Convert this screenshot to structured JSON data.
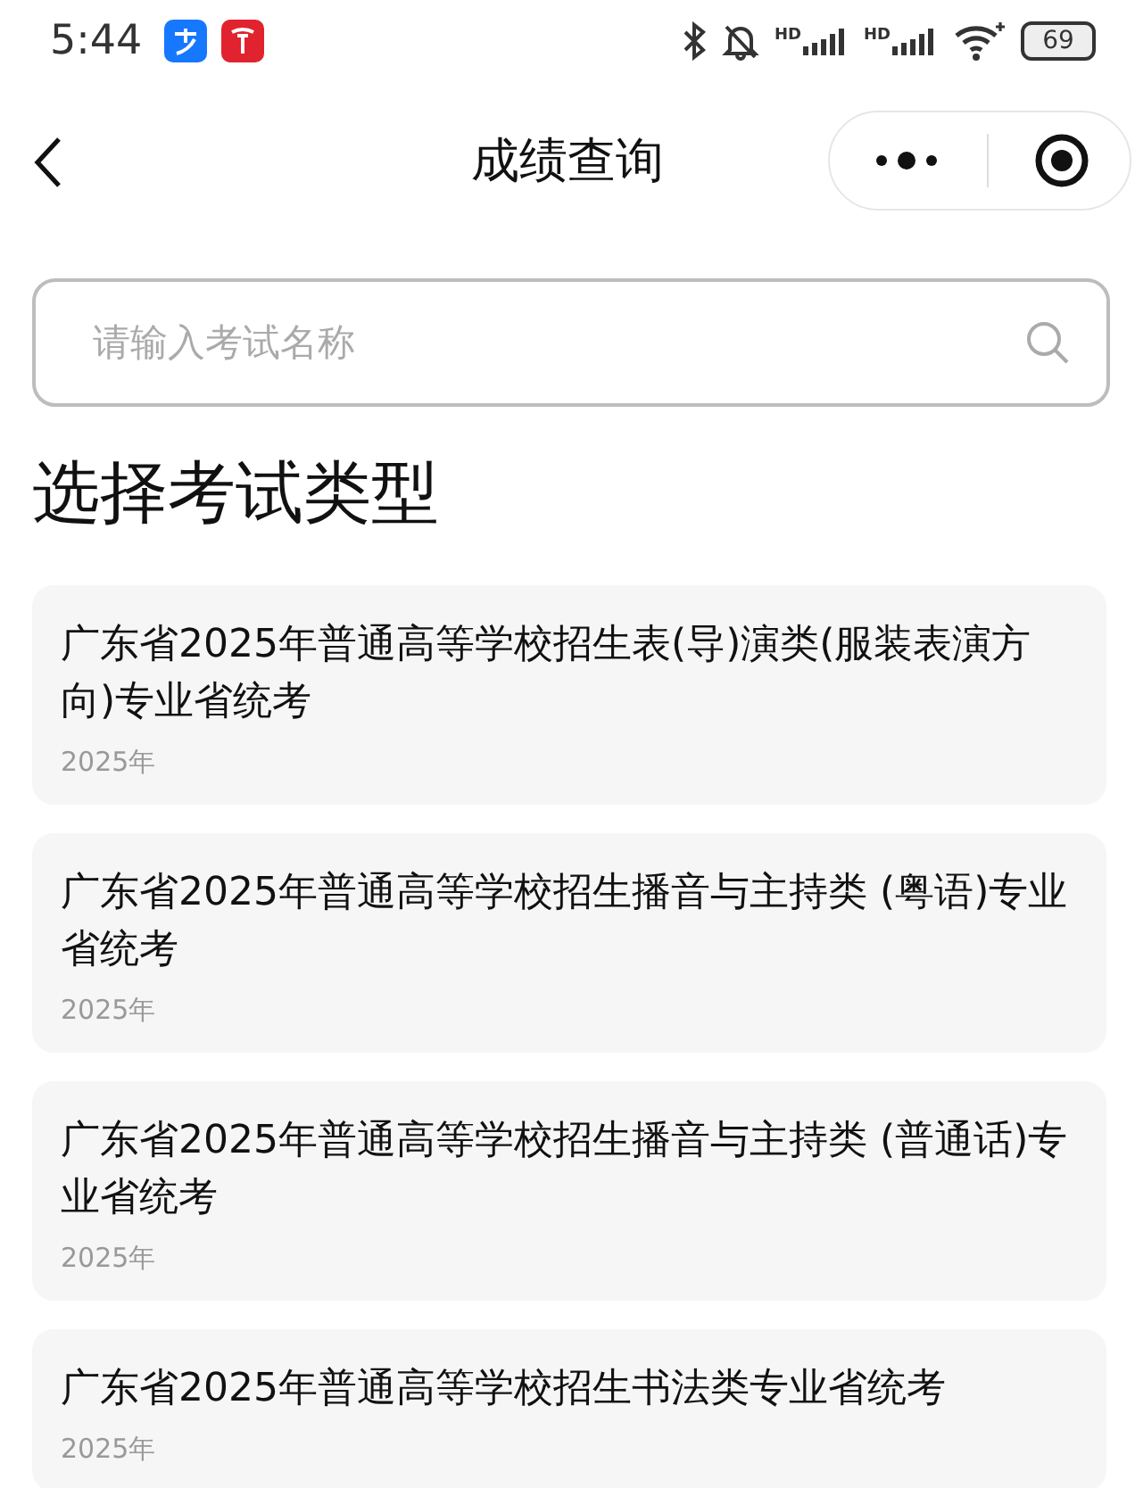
{
  "status_bar": {
    "time": "5:44",
    "signal_labels": [
      "HD",
      "HD"
    ],
    "battery": "69"
  },
  "header": {
    "title": "成绩查询"
  },
  "search": {
    "placeholder": "请输入考试名称"
  },
  "section_title": "选择考试类型",
  "exams": [
    {
      "title": "广东省2025年普通高等学校招生表(导)演类(服装表演方向)专业省统考",
      "year": "2025年"
    },
    {
      "title": "广东省2025年普通高等学校招生播音与主持类 (粤语)专业省统考",
      "year": "2025年"
    },
    {
      "title": "广东省2025年普通高等学校招生播音与主持类 (普通话)专业省统考",
      "year": "2025年"
    },
    {
      "title": "广东省2025年普通高等学校招生书法类专业省统考",
      "year": "2025年"
    }
  ]
}
